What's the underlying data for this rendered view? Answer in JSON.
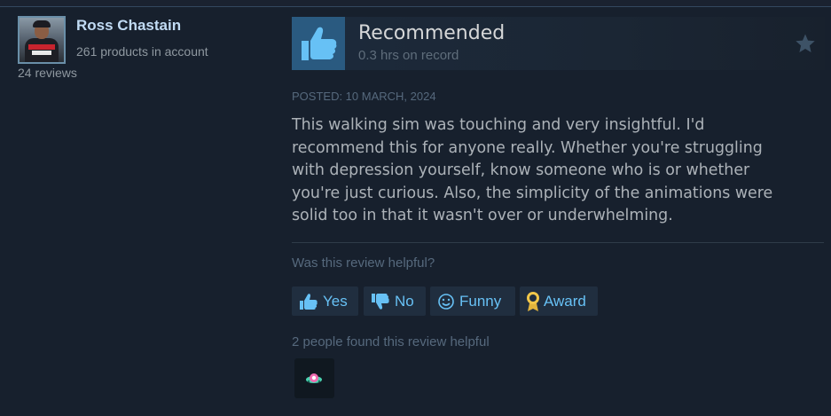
{
  "reviewer": {
    "name": "Ross Chastain",
    "products": "261 products in account",
    "reviews": "24 reviews"
  },
  "vote": {
    "title": "Recommended",
    "hours": "0.3 hrs on record",
    "icon": "thumbs-up-icon",
    "corner_icon": "star-icon"
  },
  "review": {
    "posted": "POSTED: 10 MARCH, 2024",
    "lines": [
      "This walking sim was touching and very insightful. I'd",
      "recommend this for anyone really. Whether you're struggling",
      "with depression yourself, know someone who is or whether",
      "you're just curious. Also, the simplicity of the animations were",
      "solid too in that it wasn't over or underwhelming."
    ]
  },
  "feedback": {
    "question": "Was this review helpful?",
    "buttons": {
      "yes": "Yes",
      "no": "No",
      "funny": "Funny",
      "award": "Award"
    },
    "found_helpful": "2 people found this review helpful"
  },
  "colors": {
    "background": "#17202d",
    "accent": "#67c1f5",
    "name": "#c1dbf4",
    "thumb_box": "#2a5a80"
  }
}
